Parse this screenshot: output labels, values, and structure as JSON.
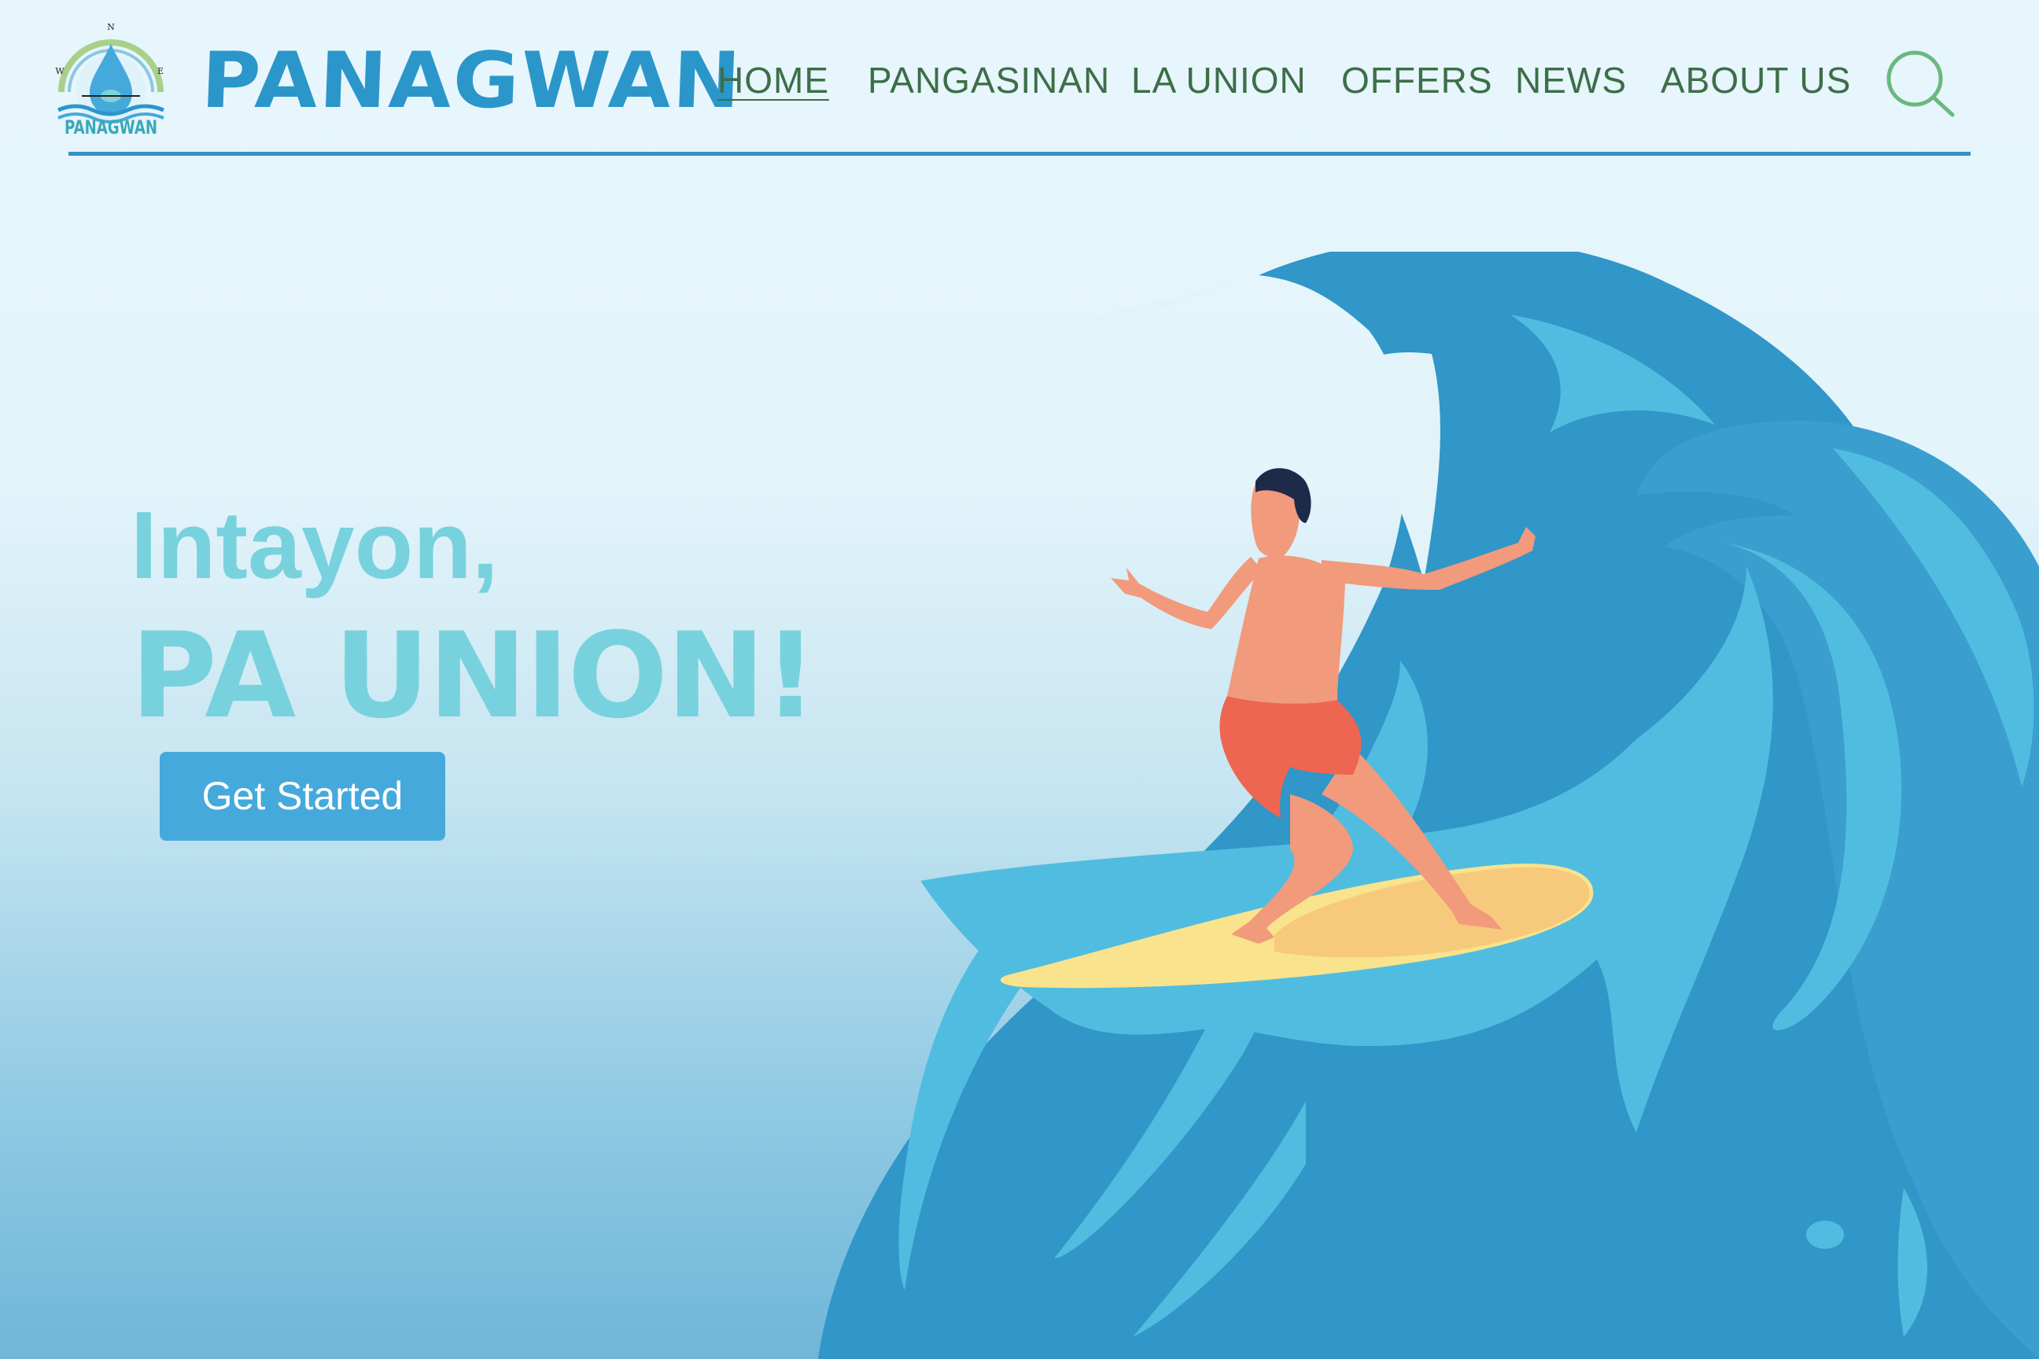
{
  "brand": {
    "name": "PANAGWAN",
    "logo_text": "PANAGWAN",
    "compass": {
      "n": "N",
      "w": "W",
      "e": "E"
    }
  },
  "nav": {
    "items": [
      {
        "label": "HOME",
        "active": true
      },
      {
        "label": "PANGASINAN",
        "active": false
      },
      {
        "label": "LA UNION",
        "active": false
      },
      {
        "label": "OFFERS",
        "active": false
      },
      {
        "label": "NEWS",
        "active": false
      },
      {
        "label": "ABOUT US",
        "active": false
      }
    ],
    "search_icon": "search-icon"
  },
  "hero": {
    "kicker": "Intayon,",
    "title": "PA UNION!",
    "cta_label": "Get Started",
    "illustration": "surfer-on-wave"
  },
  "colors": {
    "brand_blue": "#2b96c9",
    "nav_text": "#3d6e48",
    "hero_text": "#78d2dd",
    "cta_bg": "#45a9dc",
    "rule": "#3590c4",
    "wave_dark": "#3196c8",
    "wave_light": "#50bde0"
  }
}
